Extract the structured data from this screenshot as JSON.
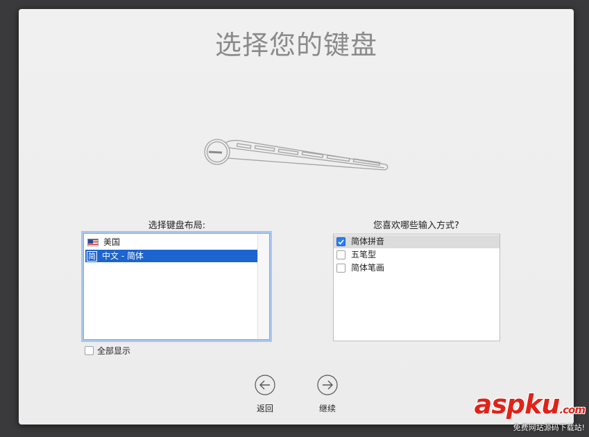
{
  "title": "选择您的键盘",
  "layout_section": {
    "label": "选择键盘布局:",
    "items": [
      {
        "label": "美国",
        "icon": "us-flag-icon",
        "selected": false
      },
      {
        "label": "中文 - 简体",
        "icon": "简",
        "selected": true
      }
    ]
  },
  "method_section": {
    "label": "您喜欢哪些输入方式?",
    "items": [
      {
        "label": "简体拼音",
        "checked": true
      },
      {
        "label": "五笔型",
        "checked": false
      },
      {
        "label": "简体笔画",
        "checked": false
      }
    ]
  },
  "show_all": {
    "label": "全部显示",
    "checked": false
  },
  "nav": {
    "back_label": "返回",
    "continue_label": "继续"
  },
  "watermark": {
    "brand": "aspku",
    "domain": ".com",
    "sub": "免费网站源码下载站!"
  },
  "colors": {
    "selection": "#1c64cf",
    "checkbox": "#2a7ef4",
    "watermark": "#e02319"
  }
}
